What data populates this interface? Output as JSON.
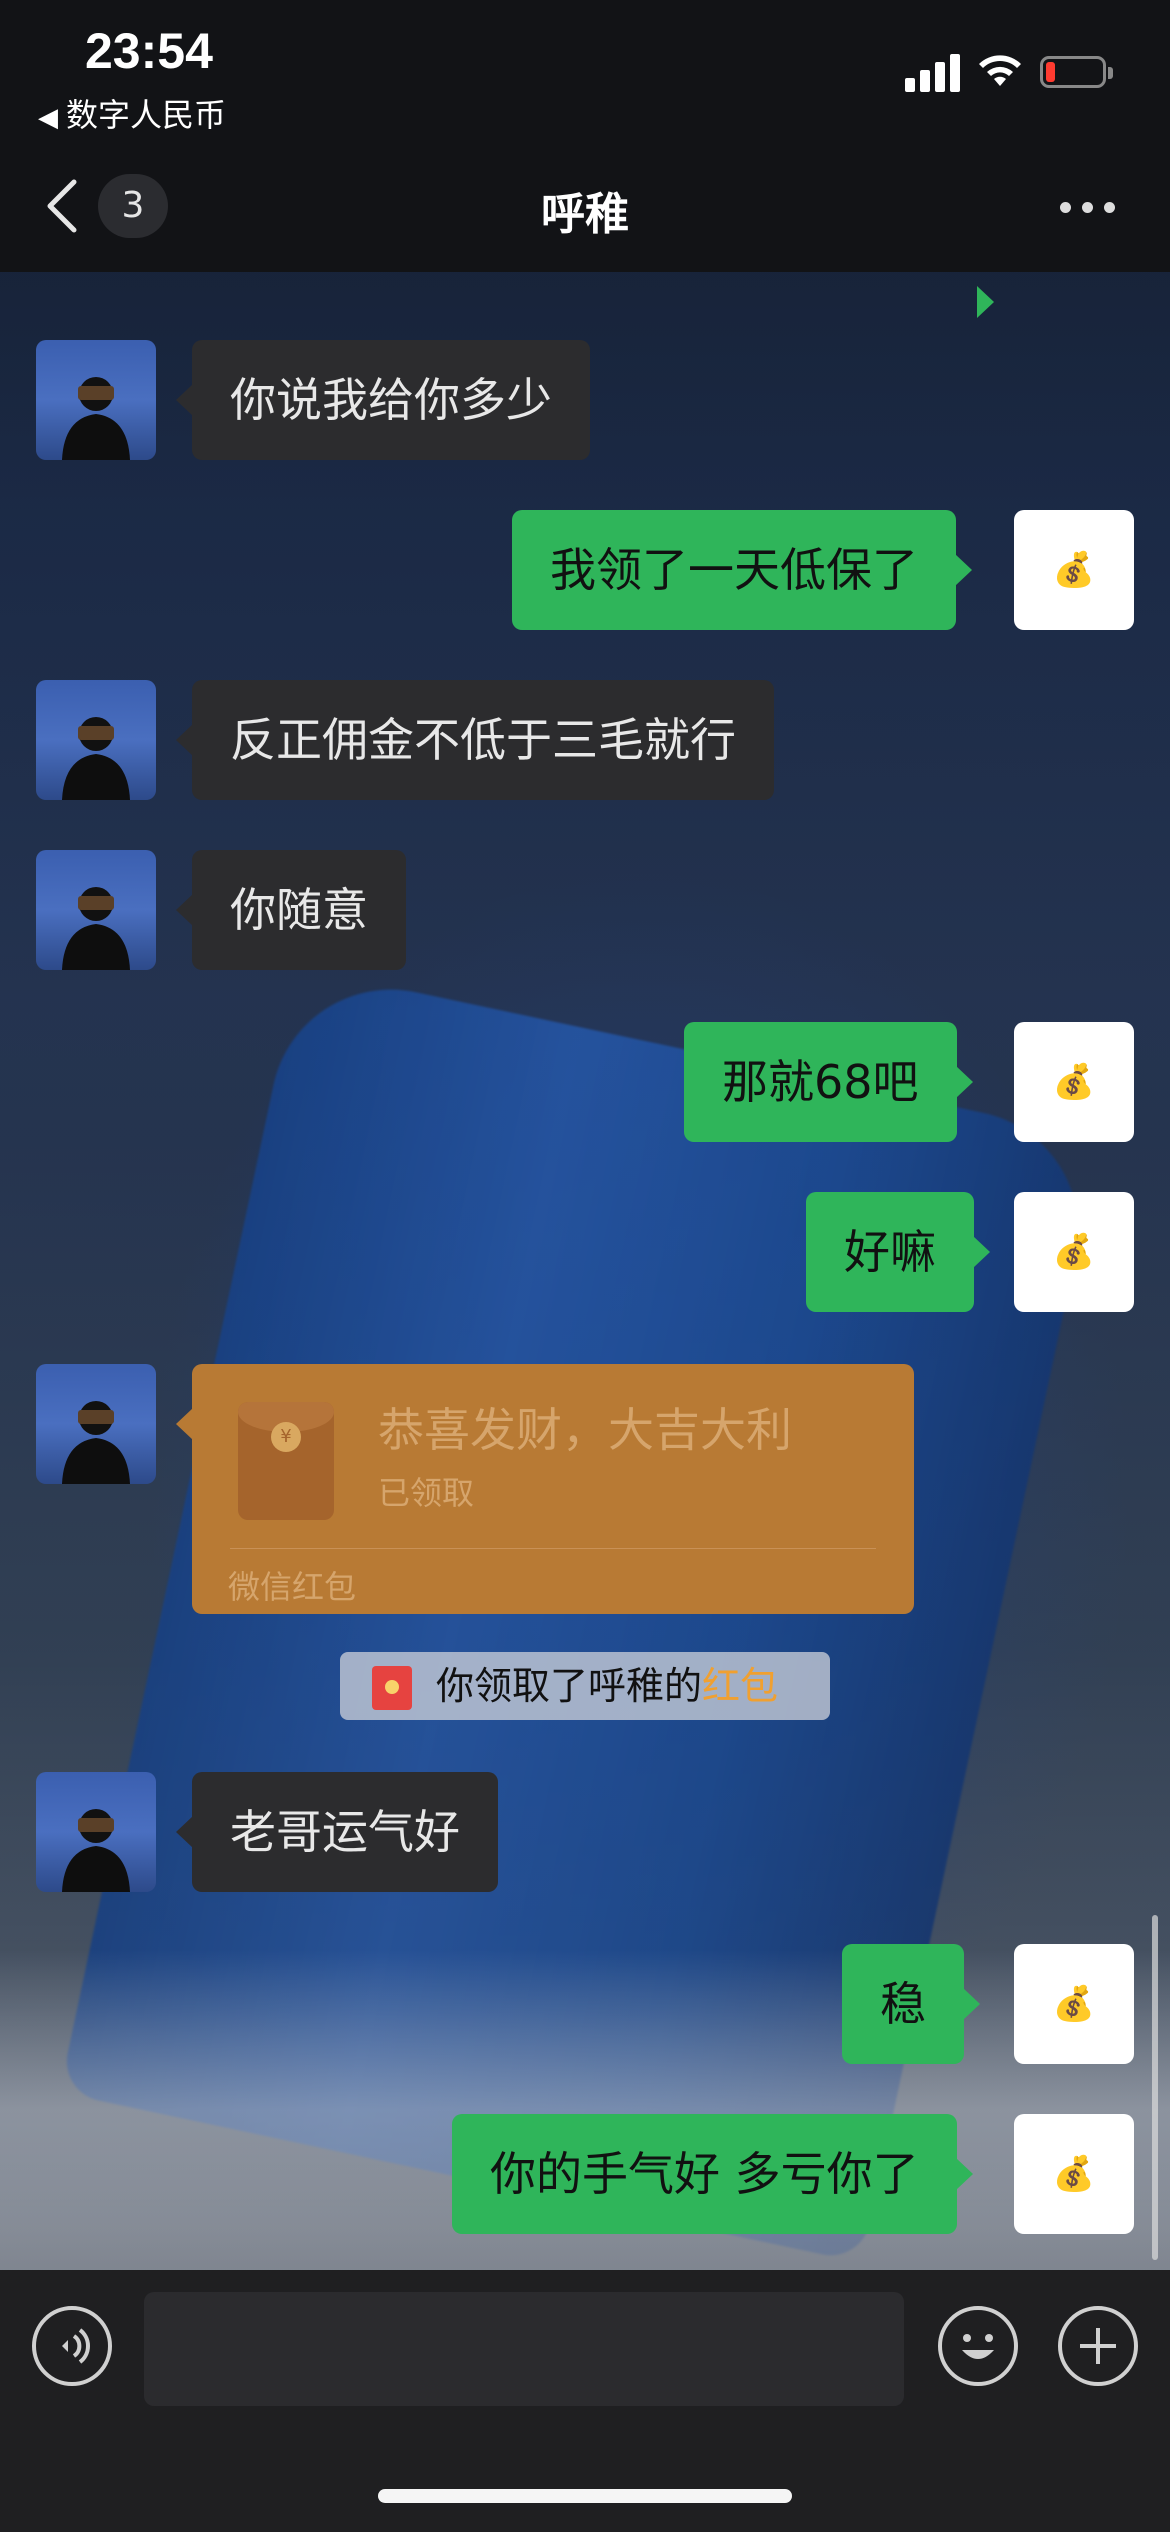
{
  "status_bar": {
    "time": "23:54",
    "back_app": "数字人民币",
    "icons": [
      "signal-icon",
      "wifi-icon",
      "battery-low-icon"
    ]
  },
  "nav": {
    "unread_count": "3",
    "title": "呼稚",
    "icons": [
      "chevron-left-icon",
      "more-icon"
    ]
  },
  "messages": [
    {
      "side": "in",
      "text": "你说我给你多少"
    },
    {
      "side": "out",
      "text": "我领了一天低保了"
    },
    {
      "side": "in",
      "text": "反正佣金不低于三毛就行"
    },
    {
      "side": "in",
      "text": "你随意"
    },
    {
      "side": "out",
      "text": "那就68吧"
    },
    {
      "side": "out",
      "text": "好嘛"
    },
    {
      "side": "in",
      "type": "red_packet"
    },
    {
      "type": "system_notice"
    },
    {
      "side": "in",
      "text": "老哥运气好"
    },
    {
      "side": "out",
      "text": "稳"
    },
    {
      "side": "out",
      "text": "你的手气好 多亏你了"
    }
  ],
  "red_packet": {
    "title": "恭喜发财，大吉大利",
    "status": "已领取",
    "footer": "微信红包"
  },
  "system_notice": {
    "text": "你领取了呼稚的",
    "highlight": "红包"
  },
  "input_bar": {
    "icons": [
      "voice-icon",
      "emoji-icon",
      "plus-icon"
    ]
  },
  "colors": {
    "outgoing_bubble": "#2fb55a",
    "incoming_bubble": "#2c2c2e",
    "red_packet": "#b87a34",
    "notice_highlight": "#f0a030"
  }
}
